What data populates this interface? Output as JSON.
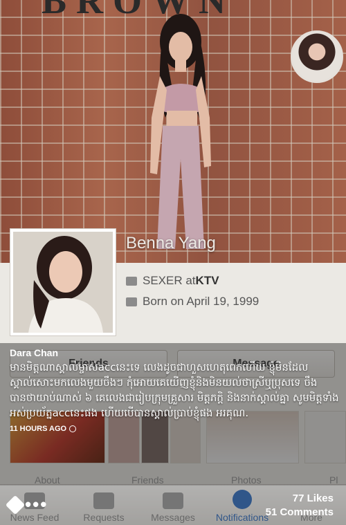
{
  "cover": {
    "sign_text": "BROWN"
  },
  "profile": {
    "name": "Benna Yang",
    "work_prefix": "SEXER at ",
    "work_place": "KTV",
    "born": "Born on April 19, 1999"
  },
  "actions": {
    "friends_label": "Friends",
    "message_label": "Message"
  },
  "sections": {
    "about": "About",
    "friends": "Friends",
    "photos": "Photos",
    "more": "Pl"
  },
  "post": {
    "author": "Dara Chan",
    "text": "មានមិត្តណាស្គាល់ម្ចាស់accនេះទេ លេងដូចជាហួសហេតុពេកហើយ ខ្ញុំមិនដែលស្គាល់សោះមកលេងមួយចឹងៗ កុំអោយគេយើញខ្ញុំនិងមិនយល់ថាស្រីឬប្រុសទេ ចឹងបានថាយាប់ណាស់ ៦ គេលេងជារៀបក្រុមគ្រួសារ មិត្តភក្តិ និងនាក់ស្គាល់គ្នា សូមមិត្តទាំងអស់ប្រយ័ត្នaccនេះផង ហើយបើបានស្គាល់ប្រាប់ខ្ញុំផង អរគុណ.",
    "time": "11 HOURS AGO",
    "likes": "77 Likes",
    "comments": "51 Comments"
  },
  "tabbar": {
    "items": [
      {
        "label": "News Feed",
        "icon": "news-feed-icon"
      },
      {
        "label": "Requests",
        "icon": "requests-icon"
      },
      {
        "label": "Messages",
        "icon": "messages-icon"
      },
      {
        "label": "Notifications",
        "icon": "notifications-globe-icon"
      },
      {
        "label": "More",
        "icon": "more-icon"
      }
    ],
    "active_color": "#3b6fb6"
  }
}
